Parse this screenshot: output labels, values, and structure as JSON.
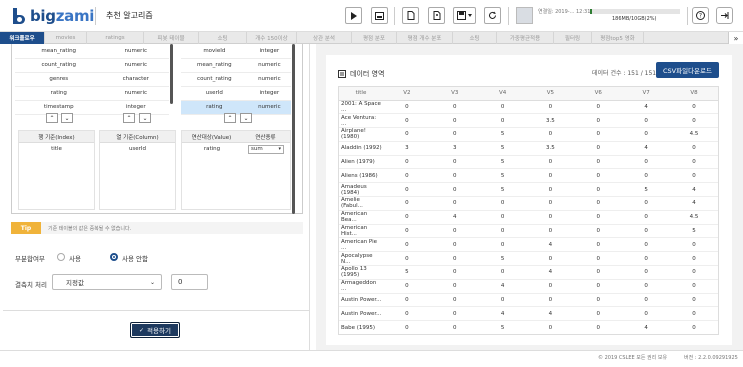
{
  "app": {
    "logo_left": "big",
    "logo_right": "zami",
    "title": "추천 알고리즘"
  },
  "user": {
    "info": "연결일: 2019-... 12:31",
    "memory": "186MB/10GB(2%)",
    "memory_fraction": 0.02
  },
  "tabs": [
    "워크플로우",
    "movies",
    "ratings",
    "피봇 테이블",
    "소팅",
    "개수 150이상",
    "상관 분석",
    "평점 분포",
    "평점 개수 분포",
    "소팅",
    "가중평균적용",
    "필터링",
    "평점top5 영화"
  ],
  "tab_arrow": "»",
  "pivot": {
    "left_list": [
      {
        "name": "mean_rating",
        "type": "numeric"
      },
      {
        "name": "count_rating",
        "type": "numeric"
      },
      {
        "name": "genres",
        "type": "character"
      },
      {
        "name": "rating",
        "type": "numeric"
      },
      {
        "name": "timestamp",
        "type": "integer"
      }
    ],
    "right_list": [
      {
        "name": "movieId",
        "type": "integer"
      },
      {
        "name": "mean_rating",
        "type": "numeric"
      },
      {
        "name": "count_rating",
        "type": "numeric"
      },
      {
        "name": "userId",
        "type": "integer"
      },
      {
        "name": "rating",
        "type": "numeric"
      }
    ],
    "row_header": "행 기준(Index)",
    "row_value": "title",
    "col_header": "열 기준(Column)",
    "col_value": "userId",
    "val_header": "연산대상(Value)",
    "func_header": "연산종류",
    "val_value": "rating",
    "func_value": "sum"
  },
  "tip": {
    "badge": "Tip",
    "text": "기준 테이블의 값은 중복될 수 없습니다."
  },
  "partial": {
    "label": "부분합여부",
    "opt_use": "사용",
    "opt_nouse": "사용 안함"
  },
  "missing": {
    "label": "결측치 처리",
    "select": "지정값",
    "value": "0"
  },
  "apply_label": "적용하기",
  "data": {
    "title": "데이터 영역",
    "count": "데이터 건수 : 151 / 151",
    "csv_label": "CSV파일다운로드",
    "columns": [
      "title",
      "V2",
      "V3",
      "V4",
      "V5",
      "V6",
      "V7",
      "V8"
    ],
    "rows": [
      [
        "2001: A Space ...",
        "0",
        "0",
        "0",
        "0",
        "0",
        "4",
        "0"
      ],
      [
        "Ace Ventura: ...",
        "0",
        "0",
        "0",
        "3.5",
        "0",
        "0",
        "0"
      ],
      [
        "Airplane! (1980)",
        "0",
        "0",
        "5",
        "0",
        "0",
        "0",
        "4.5"
      ],
      [
        "Aladdin (1992)",
        "3",
        "3",
        "5",
        "3.5",
        "0",
        "4",
        "0"
      ],
      [
        "Alien (1979)",
        "0",
        "0",
        "5",
        "0",
        "0",
        "0",
        "0"
      ],
      [
        "Aliens (1986)",
        "0",
        "0",
        "5",
        "0",
        "0",
        "0",
        "0"
      ],
      [
        "Amadeus (1984)",
        "0",
        "0",
        "5",
        "0",
        "0",
        "5",
        "4"
      ],
      [
        "Amelie (Fabul...",
        "0",
        "0",
        "0",
        "0",
        "0",
        "0",
        "4"
      ],
      [
        "American Bea...",
        "0",
        "4",
        "0",
        "0",
        "0",
        "0",
        "4.5"
      ],
      [
        "American Hist...",
        "0",
        "0",
        "0",
        "0",
        "0",
        "0",
        "5"
      ],
      [
        "American Pie ...",
        "0",
        "0",
        "0",
        "4",
        "0",
        "0",
        "0"
      ],
      [
        "Apocalypse N...",
        "0",
        "0",
        "5",
        "0",
        "0",
        "0",
        "0"
      ],
      [
        "Apollo 13 (1995)",
        "5",
        "0",
        "0",
        "4",
        "0",
        "0",
        "0"
      ],
      [
        "Armageddon ...",
        "0",
        "0",
        "4",
        "0",
        "0",
        "0",
        "0"
      ],
      [
        "Austin Power...",
        "0",
        "0",
        "0",
        "0",
        "0",
        "0",
        "0"
      ],
      [
        "Austin Power...",
        "0",
        "0",
        "4",
        "4",
        "0",
        "0",
        "0"
      ],
      [
        "Babe (1995)",
        "0",
        "0",
        "5",
        "0",
        "0",
        "4",
        "0"
      ]
    ]
  },
  "footer": {
    "copyright": "© 2019 CSLEE 모든 권리 보유",
    "version": "버전 : 2.2.0.09291925"
  }
}
